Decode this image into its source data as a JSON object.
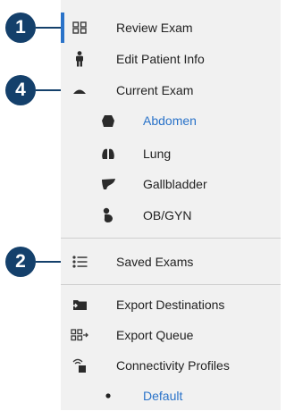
{
  "colors": {
    "accent": "#2a73c9",
    "callout": "#14406b",
    "menu_bg": "#f1f1f1",
    "icon": "#3a3a3a"
  },
  "callouts": [
    "1",
    "4",
    "2"
  ],
  "menu": {
    "review_exam": {
      "label": "Review Exam",
      "icon": "grid-icon"
    },
    "edit_patient": {
      "label": "Edit Patient Info",
      "icon": "person-icon"
    },
    "current_exam": {
      "label": "Current Exam",
      "icon": "caret-up-icon"
    },
    "exam_types": [
      {
        "label": "Abdomen",
        "icon": "torso-icon",
        "selected": true
      },
      {
        "label": "Lung",
        "icon": "lungs-icon",
        "selected": false
      },
      {
        "label": "Gallbladder",
        "icon": "liver-icon",
        "selected": false
      },
      {
        "label": "OB/GYN",
        "icon": "fetus-icon",
        "selected": false
      }
    ],
    "saved_exams": {
      "label": "Saved Exams",
      "icon": "list-icon"
    },
    "export_destinations": {
      "label": "Export Destinations",
      "icon": "export-folder-icon"
    },
    "export_queue": {
      "label": "Export Queue",
      "icon": "queue-icon"
    },
    "connectivity_profiles": {
      "label": "Connectivity Profiles",
      "icon": "wifi-device-icon"
    },
    "profiles": [
      {
        "label": "Default",
        "selected": true
      }
    ]
  }
}
